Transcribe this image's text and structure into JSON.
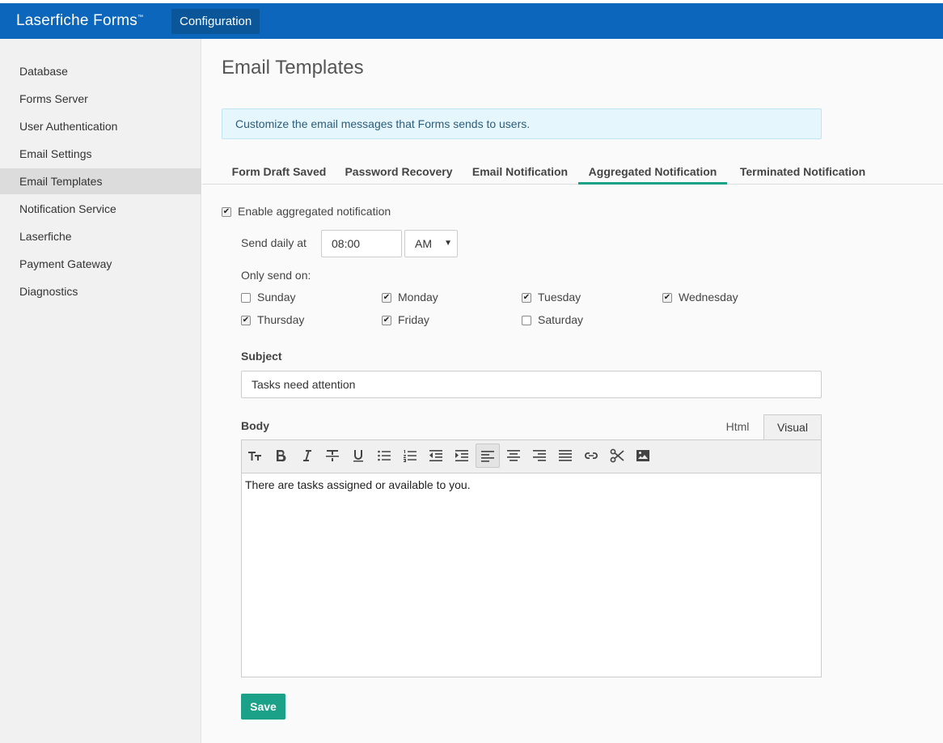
{
  "header": {
    "brand": "Laserfiche Forms",
    "trademark": "™",
    "config_label": "Configuration"
  },
  "sidebar": {
    "items": [
      {
        "label": "Database"
      },
      {
        "label": "Forms Server"
      },
      {
        "label": "User Authentication"
      },
      {
        "label": "Email Settings"
      },
      {
        "label": "Email Templates",
        "active": true
      },
      {
        "label": "Notification Service"
      },
      {
        "label": "Laserfiche"
      },
      {
        "label": "Payment Gateway"
      },
      {
        "label": "Diagnostics"
      }
    ]
  },
  "main": {
    "title": "Email Templates",
    "info": "Customize the email messages that Forms sends to users.",
    "tabs": [
      {
        "label": "Form Draft Saved"
      },
      {
        "label": "Password Recovery"
      },
      {
        "label": "Email Notification"
      },
      {
        "label": "Aggregated Notification",
        "active": true
      },
      {
        "label": "Terminated Notification"
      }
    ],
    "enable_label": "Enable aggregated notification",
    "enable_checked": true,
    "send_daily_label": "Send daily at",
    "time_value": "08:00",
    "ampm_value": "AM",
    "only_send_label": "Only send on:",
    "days": [
      {
        "label": "Sunday",
        "checked": false
      },
      {
        "label": "Monday",
        "checked": true
      },
      {
        "label": "Tuesday",
        "checked": true
      },
      {
        "label": "Wednesday",
        "checked": true
      },
      {
        "label": "Thursday",
        "checked": true
      },
      {
        "label": "Friday",
        "checked": true
      },
      {
        "label": "Saturday",
        "checked": false
      }
    ],
    "subject_label": "Subject",
    "subject_value": "Tasks need attention",
    "body_label": "Body",
    "mode_tabs": [
      {
        "label": "Html"
      },
      {
        "label": "Visual",
        "active": true
      }
    ],
    "body_text": "There are tasks assigned or available to you.",
    "save_label": "Save"
  },
  "toolbar_icons": [
    "text-size-icon",
    "bold-icon",
    "italic-icon",
    "strikethrough-icon",
    "underline-icon",
    "bullet-list-icon",
    "numbered-list-icon",
    "outdent-icon",
    "indent-icon",
    "align-left-icon",
    "align-center-icon",
    "align-right-icon",
    "align-justify-icon",
    "link-icon",
    "cut-icon",
    "image-icon"
  ],
  "colors": {
    "header": "#0c66bb",
    "accent": "#1aa187",
    "info_bg": "#e6f6fd"
  }
}
